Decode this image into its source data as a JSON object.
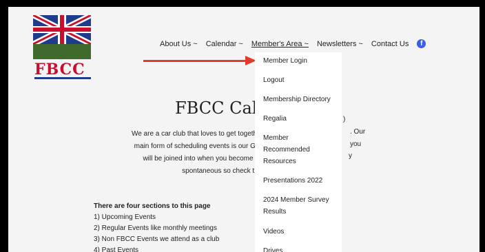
{
  "logo": {
    "text": "FBCC"
  },
  "nav": {
    "items": [
      {
        "label": "About Us ~"
      },
      {
        "label": "Calendar ~"
      },
      {
        "label": "Member's Area ~"
      },
      {
        "label": "Newsletters ~"
      },
      {
        "label": "Contact Us"
      }
    ],
    "facebook_icon": "f"
  },
  "page": {
    "title": "FBCC Cal",
    "intro_lines": [
      "We are a car club that loves to get together",
      "main form of scheduling events is our Goo",
      "will be joined into when you become a r",
      "spontaneous so check this"
    ],
    "right_fragments": [
      ")",
      ". Our",
      "you",
      "y"
    ],
    "sections_heading": "There are four sections to this page",
    "sections": [
      "1) Upcoming Events",
      "2) Regular Events like monthly meetings",
      "3) Non FBCC Events we attend as a club",
      "4) Past Events"
    ]
  },
  "dropdown": {
    "items": [
      "Member Login",
      "Logout",
      "Membership Directory",
      "Regalia",
      "Member Recommended Resources",
      "Presentations 2022",
      "2024 Member Survey Results",
      "Videos",
      "Drives"
    ]
  },
  "colors": {
    "arrow": "#e03a2a",
    "facebook": "#3b5de7",
    "logo_red": "#c8102e",
    "flag_blue": "#1f3b8c"
  }
}
